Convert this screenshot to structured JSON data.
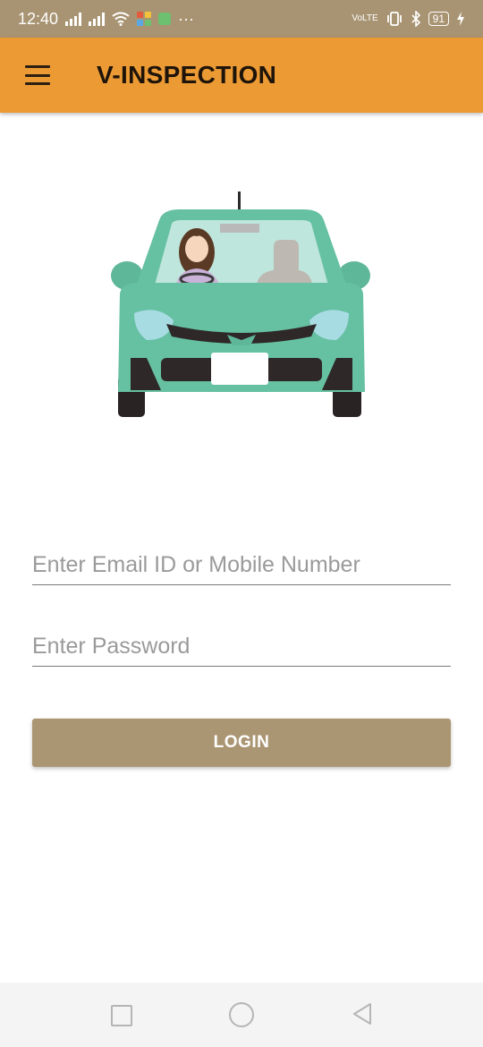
{
  "status_bar": {
    "time": "12:40",
    "more_indicator": "···",
    "network_label": "VoLTE",
    "battery_level": "91",
    "icons": [
      "signal-icon",
      "signal-icon",
      "wifi-icon",
      "app-notification-icon",
      "vibrate-icon",
      "bluetooth-icon",
      "battery-icon",
      "charging-icon"
    ]
  },
  "app_bar": {
    "title": "V-INSPECTION",
    "menu_icon": "hamburger-menu-icon",
    "background_color": "#ec9a34"
  },
  "illustration": {
    "description_icon": "car-with-driver-illustration"
  },
  "login_form": {
    "email_placeholder": "Enter Email ID or Mobile Number",
    "password_placeholder": "Enter Password",
    "login_label": "LOGIN",
    "button_color": "#ab9674"
  },
  "nav_bar": {
    "icons": [
      "recents-square-icon",
      "home-circle-icon",
      "back-triangle-icon"
    ]
  }
}
